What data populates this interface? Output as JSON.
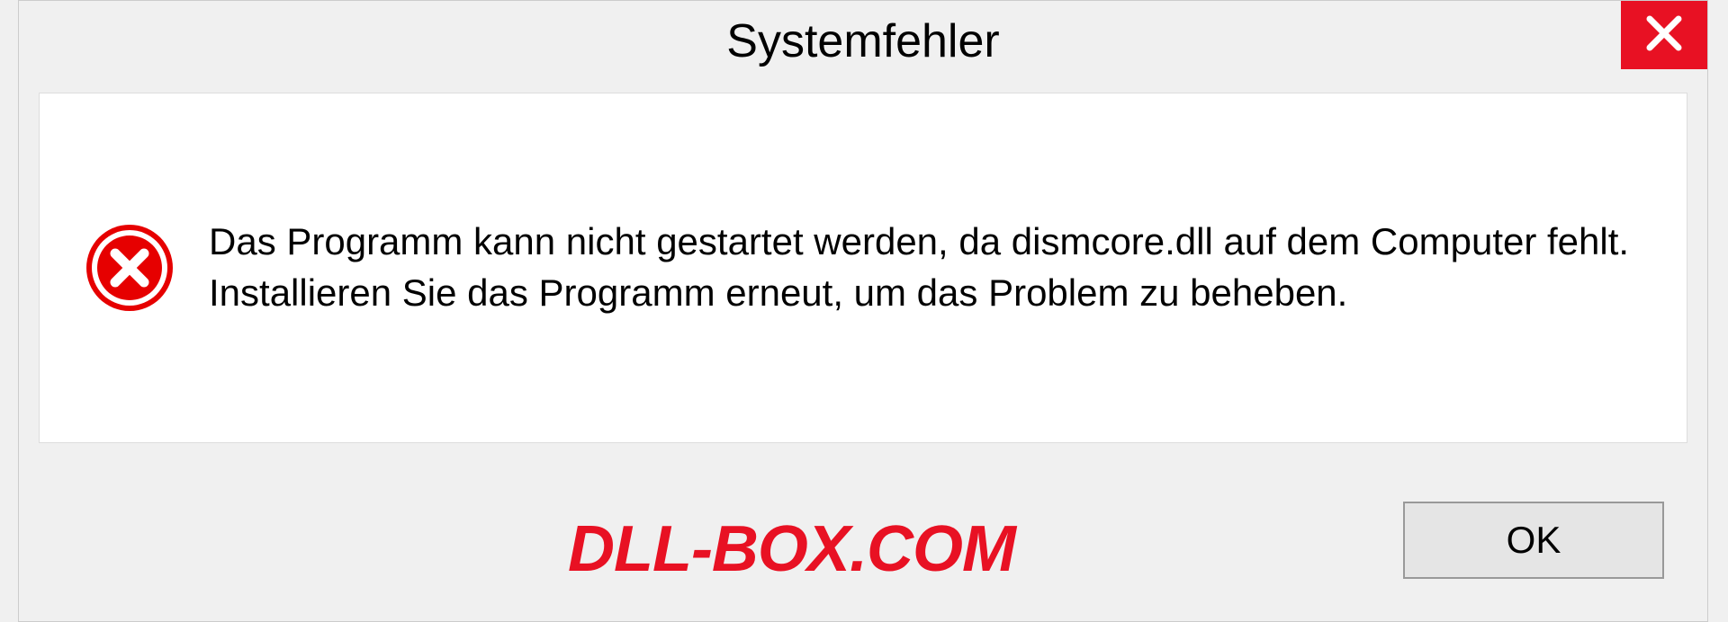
{
  "dialog": {
    "title": "Systemfehler",
    "message": "Das Programm kann nicht gestartet werden, da dismcore.dll auf dem Computer fehlt. Installieren Sie das Programm erneut, um das Problem zu beheben.",
    "ok_label": "OK"
  },
  "watermark": "DLL-BOX.COM",
  "colors": {
    "error_red": "#e81123",
    "panel_bg": "#ffffff",
    "dialog_bg": "#f0f0f0"
  }
}
